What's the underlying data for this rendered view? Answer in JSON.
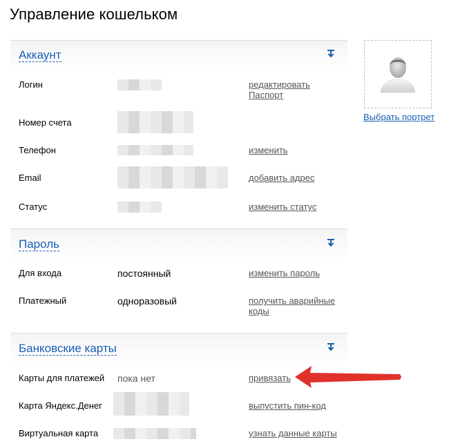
{
  "page": {
    "title": "Управление кошельком"
  },
  "portrait": {
    "link_label": "Выбрать портрет",
    "icon": "user-silhouette-icon"
  },
  "account": {
    "title": "Аккаунт",
    "rows": [
      {
        "label": "Логин",
        "action": "редактировать",
        "action2": "Паспорт"
      },
      {
        "label": "Номер счета"
      },
      {
        "label": "Телефон",
        "action": "изменить"
      },
      {
        "label": "Email",
        "action": "добавить адрес"
      },
      {
        "label": "Статус",
        "action": "изменить статус"
      }
    ]
  },
  "password": {
    "title": "Пароль",
    "rows": [
      {
        "label": "Для входа",
        "value": "постоянный",
        "action": "изменить пароль"
      },
      {
        "label": "Платежный",
        "value": "одноразовый",
        "action": "получить аварийные",
        "action2": "коды"
      }
    ]
  },
  "cards": {
    "title": "Банковские карты",
    "rows": [
      {
        "label": "Карты для платежей",
        "value": "пока нет",
        "action": "привязать"
      },
      {
        "label": "Карта Яндекс.Денег",
        "action": "выпустить пин-код"
      },
      {
        "label": "Виртуальная карта",
        "action": "узнать данные карты"
      }
    ]
  },
  "colors": {
    "link_blue": "#1a5fb4",
    "arrow_red": "#e0322b"
  }
}
